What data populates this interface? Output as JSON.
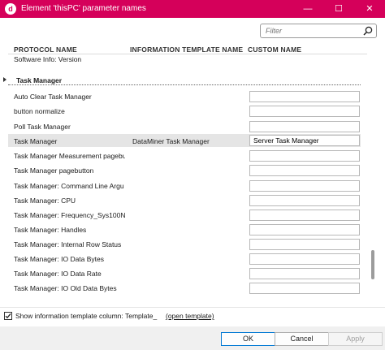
{
  "window": {
    "app_icon_letter": "d",
    "title": "Element 'thisPC' parameter names",
    "minimize_glyph": "—",
    "maximize_glyph": "☐",
    "close_glyph": "✕"
  },
  "filter": {
    "placeholder": "Filter",
    "icon": "search-icon"
  },
  "columns": {
    "protocol": "PROTOCOL NAME",
    "template": "INFORMATION TEMPLATE NAME",
    "custom": "CUSTOM NAME"
  },
  "partial_row": {
    "protocol": "Software Info: Version"
  },
  "group": {
    "label": "Task Manager",
    "expanded": false
  },
  "rows": [
    {
      "protocol": "Auto Clear Task Manager",
      "template": "",
      "custom": ""
    },
    {
      "protocol": "button normalize",
      "template": "",
      "custom": ""
    },
    {
      "protocol": "Poll Task Manager",
      "template": "",
      "custom": ""
    },
    {
      "protocol": "Task Manager",
      "template": "DataMiner Task Manager",
      "custom": "Server Task Manager",
      "selected": true
    },
    {
      "protocol": "Task Manager Measurement pagebu",
      "template": "",
      "custom": ""
    },
    {
      "protocol": "Task Manager pagebutton",
      "template": "",
      "custom": ""
    },
    {
      "protocol": "Task Manager: Command Line Argu",
      "template": "",
      "custom": ""
    },
    {
      "protocol": "Task Manager: CPU",
      "template": "",
      "custom": ""
    },
    {
      "protocol": "Task Manager: Frequency_Sys100NS",
      "template": "",
      "custom": ""
    },
    {
      "protocol": "Task Manager: Handles",
      "template": "",
      "custom": ""
    },
    {
      "protocol": "Task Manager: Internal Row Status",
      "template": "",
      "custom": ""
    },
    {
      "protocol": "Task Manager: IO Data Bytes",
      "template": "",
      "custom": ""
    },
    {
      "protocol": "Task Manager: IO Data Rate",
      "template": "",
      "custom": ""
    },
    {
      "protocol": "Task Manager: IO Old Data Bytes",
      "template": "",
      "custom": ""
    }
  ],
  "options": {
    "show_template_checked": true,
    "show_template_label": "Show information template column: Template_",
    "open_template_link": "(open template)"
  },
  "buttons": {
    "ok": "OK",
    "cancel": "Cancel",
    "apply": "Apply"
  }
}
